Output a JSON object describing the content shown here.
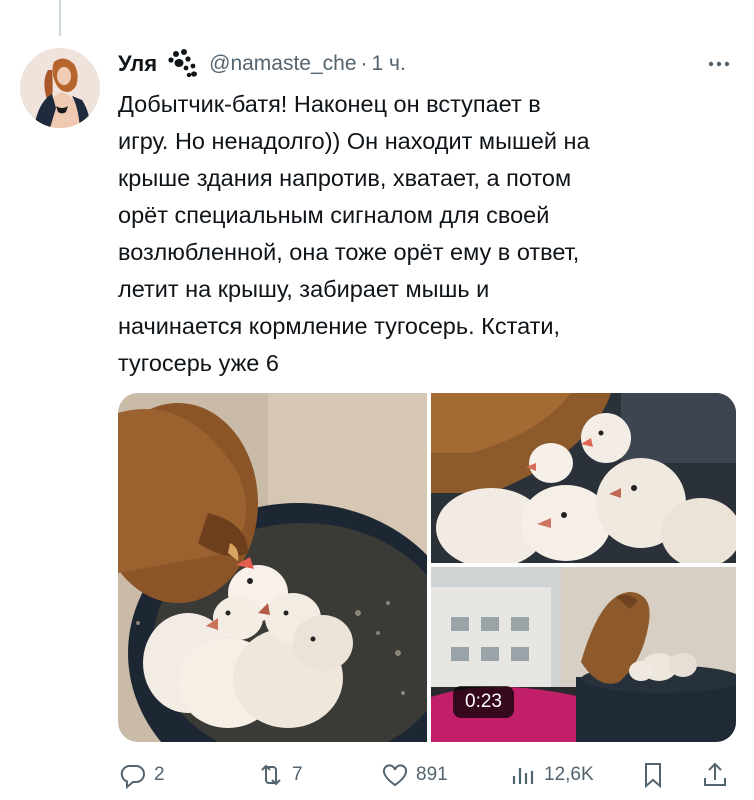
{
  "tweet": {
    "author_name": "Уля",
    "handle": "@namaste_che",
    "separator": "·",
    "time": "1 ч.",
    "text": "Добытчик-батя! Наконец он вступает в\nигру. Но ненадолго)) Он находит мышей на\nкрыше здания напротив, хватает, а потом\nорёт специальным сигналом для своей\nвозлюбленной, она тоже орёт ему в ответ,\nлетит на крышу, забирает мышь и\nначинается кормление тугосерь. Кстати,\nтугосерь уже 6"
  },
  "media": {
    "video_duration": "0:23"
  },
  "actions": {
    "replies": "2",
    "reposts": "7",
    "likes": "891",
    "views": "12,6K"
  },
  "colors": {
    "secondary_text": "#536471",
    "primary_text": "#0f1419"
  },
  "icons": [
    "paw-icon",
    "more-icon",
    "reply-icon",
    "repost-icon",
    "like-icon",
    "views-icon",
    "bookmark-icon",
    "share-icon"
  ]
}
